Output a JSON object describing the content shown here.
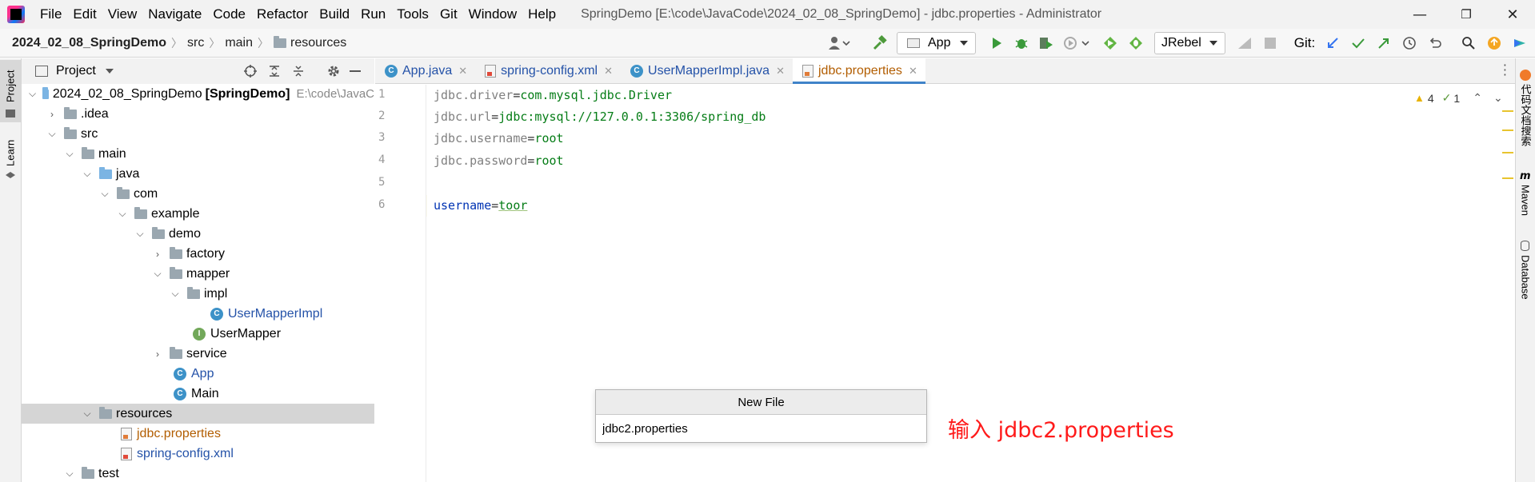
{
  "titlebar": {
    "menu": [
      {
        "label": "File"
      },
      {
        "label": "Edit"
      },
      {
        "label": "View"
      },
      {
        "label": "Navigate"
      },
      {
        "label": "Code"
      },
      {
        "label": "Refactor"
      },
      {
        "label": "Build"
      },
      {
        "label": "Run"
      },
      {
        "label": "Tools"
      },
      {
        "label": "Git"
      },
      {
        "label": "Window"
      },
      {
        "label": "Help"
      }
    ],
    "window_title": "SpringDemo [E:\\code\\JavaCode\\2024_02_08_SpringDemo] - jdbc.properties - Administrator",
    "minimize_icon": "—",
    "restore_icon": "❐",
    "close_icon": "✕"
  },
  "navbar": {
    "breadcrumbs": [
      "2024_02_08_SpringDemo",
      "src",
      "main",
      "resources"
    ],
    "run_config": "App",
    "jrebel": "JRebel",
    "git_label": "Git:"
  },
  "left_strip": {
    "project_tab": "Project",
    "learn_tab": "Learn"
  },
  "project_panel": {
    "title": "Project",
    "tree": [
      {
        "label": "2024_02_08_SpringDemo",
        "suffix": "[SpringDemo]",
        "path": "E:\\code\\JavaC"
      },
      {
        "label": ".idea"
      },
      {
        "label": "src"
      },
      {
        "label": "main"
      },
      {
        "label": "java"
      },
      {
        "label": "com"
      },
      {
        "label": "example"
      },
      {
        "label": "demo"
      },
      {
        "label": "factory"
      },
      {
        "label": "mapper"
      },
      {
        "label": "impl"
      },
      {
        "label": "UserMapperImpl"
      },
      {
        "label": "UserMapper"
      },
      {
        "label": "service"
      },
      {
        "label": "App"
      },
      {
        "label": "Main"
      },
      {
        "label": "resources"
      },
      {
        "label": "jdbc.properties"
      },
      {
        "label": "spring-config.xml"
      },
      {
        "label": "test"
      }
    ]
  },
  "editor": {
    "tabs": [
      {
        "label": "App.java"
      },
      {
        "label": "spring-config.xml"
      },
      {
        "label": "UserMapperImpl.java"
      },
      {
        "label": "jdbc.properties"
      }
    ],
    "line_numbers": [
      "1",
      "2",
      "3",
      "4",
      "5",
      "6"
    ],
    "lines": [
      {
        "key": "jdbc.driver",
        "value": "com.mysql.jdbc.Driver"
      },
      {
        "key": "jdbc.url",
        "value": "jdbc:mysql://127.0.0.1:3306/spring_db"
      },
      {
        "key": "jdbc.username",
        "value": "root"
      },
      {
        "key": "jdbc.password",
        "value": "root"
      },
      {
        "key": "",
        "value": ""
      },
      {
        "key": "username",
        "value": "toor"
      }
    ],
    "warnings": "4",
    "weak_warnings": "1"
  },
  "right_strip": {
    "tab1": "代码文档搜索",
    "maven": "Maven",
    "database": "Database"
  },
  "new_file": {
    "title": "New File",
    "value": "jdbc2.properties"
  },
  "annotation": "输入 jdbc2.properties",
  "colors": {
    "accent": "#4083c9",
    "annotation": "#ff1a1a",
    "string_value": "#067d17"
  }
}
